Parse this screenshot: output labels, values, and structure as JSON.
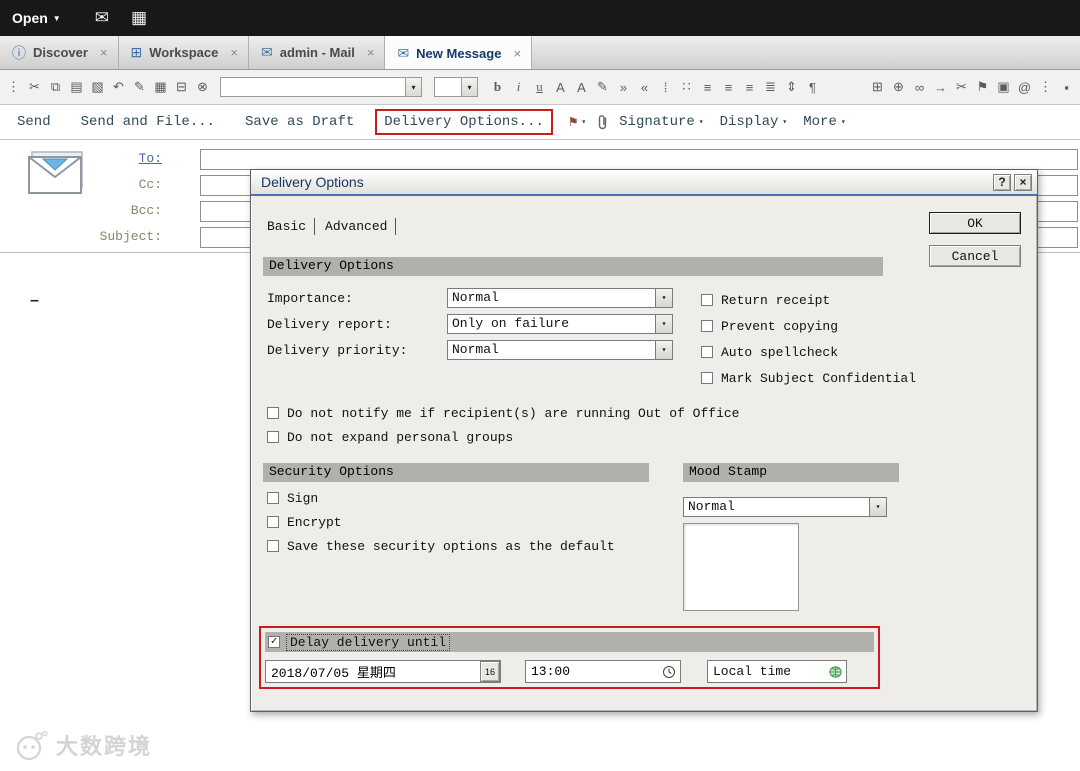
{
  "glyphs": {
    "caret": "▾",
    "menu_caret": "▼",
    "check": "✓",
    "close": "×",
    "help": "?",
    "tab_close": "×",
    "flag": "⚑",
    "tab_sep": "|"
  },
  "topbar": {
    "open_label": "Open",
    "icons": [
      {
        "name": "mail-icon",
        "glyph": "✉"
      },
      {
        "name": "calendar-icon",
        "glyph": "▦"
      }
    ]
  },
  "tabs": [
    {
      "name": "tab-discover",
      "icon_name": "info-icon",
      "icon_glyph": "ⓘ",
      "label": "Discover",
      "active": false
    },
    {
      "name": "tab-workspace",
      "icon_name": "workspace-grid-icon",
      "icon_glyph": "⊞",
      "label": "Workspace",
      "active": false
    },
    {
      "name": "tab-admin-mail",
      "icon_name": "mail-tab-icon",
      "icon_glyph": "✉",
      "label": "admin - Mail",
      "active": false
    },
    {
      "name": "tab-new-message",
      "icon_name": "compose-mail-icon",
      "icon_glyph": "✉",
      "label": "New Message",
      "active": true
    }
  ],
  "toolbar": {
    "left_icons": [
      {
        "name": "toolbar-handle-icon",
        "glyph": "⋮"
      },
      {
        "name": "cut-icon",
        "glyph": "✂"
      },
      {
        "name": "copy-icon",
        "glyph": "⧉"
      },
      {
        "name": "paste-icon",
        "glyph": "▤"
      },
      {
        "name": "format-painter-icon",
        "glyph": "▧"
      },
      {
        "name": "undo-icon",
        "glyph": "↶"
      },
      {
        "name": "permanent-pen-icon",
        "glyph": "✎"
      },
      {
        "name": "insert-image-icon",
        "glyph": "▦"
      },
      {
        "name": "print-icon",
        "glyph": "⊟"
      },
      {
        "name": "delete-icon",
        "glyph": "⊗"
      }
    ],
    "font_combo_value": "",
    "size_combo_value": "",
    "format_icons": [
      {
        "name": "bold-icon",
        "glyph": "b",
        "cls": "bold"
      },
      {
        "name": "italic-icon",
        "glyph": "i",
        "cls": "ital"
      },
      {
        "name": "underline-icon",
        "glyph": "u",
        "cls": "und"
      },
      {
        "name": "text-color-icon",
        "glyph": "A",
        "cls": ""
      },
      {
        "name": "highlighter-icon",
        "glyph": "A",
        "cls": ""
      },
      {
        "name": "pencil-icon",
        "glyph": "✎",
        "cls": ""
      },
      {
        "name": "indent-icon",
        "glyph": "»",
        "cls": ""
      },
      {
        "name": "outdent-icon",
        "glyph": "«",
        "cls": ""
      },
      {
        "name": "numbered-list-icon",
        "glyph": "⁞",
        "cls": ""
      },
      {
        "name": "bullet-list-icon",
        "glyph": "∷",
        "cls": ""
      },
      {
        "name": "align-left-icon",
        "glyph": "≡",
        "cls": ""
      },
      {
        "name": "align-center-icon",
        "glyph": "≡",
        "cls": ""
      },
      {
        "name": "align-right-icon",
        "glyph": "≡",
        "cls": ""
      },
      {
        "name": "justify-icon",
        "glyph": "≣",
        "cls": ""
      },
      {
        "name": "line-spacing-icon",
        "glyph": "⇕",
        "cls": ""
      },
      {
        "name": "paragraph-style-icon",
        "glyph": "¶",
        "cls": ""
      }
    ],
    "right_icons": [
      {
        "name": "table-icon",
        "glyph": "⊞"
      },
      {
        "name": "attach-file-icon",
        "glyph": "⊕"
      },
      {
        "name": "link-icon",
        "glyph": "∞"
      },
      {
        "name": "forward-arrow-icon",
        "glyph": "→"
      },
      {
        "name": "stamp-icon",
        "glyph": "✂"
      },
      {
        "name": "flag-icon",
        "glyph": "⚑"
      },
      {
        "name": "frame-icon",
        "glyph": "▣"
      },
      {
        "name": "object-icon",
        "glyph": "@"
      },
      {
        "name": "overflow-menu-icon",
        "glyph": "⋮"
      },
      {
        "name": "app-icon",
        "glyph": "▪"
      }
    ]
  },
  "action_bar": {
    "buttons": [
      {
        "name": "send-button",
        "label": "Send",
        "annotated": false
      },
      {
        "name": "send-and-file-button",
        "label": "Send and File...",
        "annotated": false
      },
      {
        "name": "save-as-draft-button",
        "label": "Save as Draft",
        "annotated": false
      },
      {
        "name": "delivery-options-button",
        "label": "Delivery Options...",
        "annotated": true
      }
    ],
    "menus": [
      {
        "name": "signature-menu",
        "label": "Signature"
      },
      {
        "name": "display-menu",
        "label": "Display"
      },
      {
        "name": "more-menu",
        "label": "More"
      }
    ]
  },
  "compose": {
    "to_label": "To:",
    "cc_label": "Cc:",
    "bcc_label": "Bcc:",
    "subject_label": "Subject:",
    "to_value": "",
    "cc_value": "",
    "bcc_value": "",
    "subject_value": "",
    "body_marker": "–"
  },
  "dialog": {
    "title": "Delivery Options",
    "tabs": [
      {
        "name": "dialog-tab-basic",
        "label": "Basic",
        "active": true
      },
      {
        "name": "dialog-tab-advanced",
        "label": "Advanced",
        "active": false
      }
    ],
    "ok_label": "OK",
    "cancel_label": "Cancel",
    "delivery_section_header": "Delivery Options",
    "rows": [
      {
        "name": "importance-select",
        "label": "Importance:",
        "value": "Normal"
      },
      {
        "name": "delivery-report-select",
        "label": "Delivery report:",
        "value": "Only on failure"
      },
      {
        "name": "delivery-priority-select",
        "label": "Delivery priority:",
        "value": "Normal"
      }
    ],
    "right_checks": [
      {
        "name": "return-receipt-checkbox",
        "label": "Return receipt",
        "checked": false,
        "tick": ""
      },
      {
        "name": "prevent-copying-checkbox",
        "label": "Prevent copying",
        "checked": false,
        "tick": ""
      },
      {
        "name": "auto-spellcheck-checkbox",
        "label": "Auto spellcheck",
        "checked": false,
        "tick": ""
      },
      {
        "name": "mark-subject-confidential-checkbox",
        "label": "Mark Subject Confidential",
        "checked": false,
        "tick": ""
      }
    ],
    "mid_checks": [
      {
        "name": "no-out-of-office-notify-checkbox",
        "label": "Do not notify me if recipient(s) are running Out of Office",
        "checked": false,
        "tick": ""
      },
      {
        "name": "no-expand-personal-groups-checkbox",
        "label": "Do not expand personal groups",
        "checked": false,
        "tick": ""
      }
    ],
    "security_section_header": "Security Options",
    "mood_section_header": "Mood Stamp",
    "security_checks": [
      {
        "name": "sign-checkbox",
        "label": "Sign",
        "checked": false,
        "tick": ""
      },
      {
        "name": "encrypt-checkbox",
        "label": "Encrypt",
        "checked": false,
        "tick": ""
      },
      {
        "name": "save-security-default-checkbox",
        "label": "Save these security options as the default",
        "checked": false,
        "tick": ""
      }
    ],
    "mood_value": "Normal",
    "delay": {
      "label": "Delay delivery until",
      "checked": true,
      "tick": "✓",
      "date_value": "2018/07/05 星期四",
      "date_button_label": "16",
      "time_value": "13:00",
      "timezone_value": "Local time"
    }
  },
  "watermark": {
    "text": "大数跨境"
  }
}
